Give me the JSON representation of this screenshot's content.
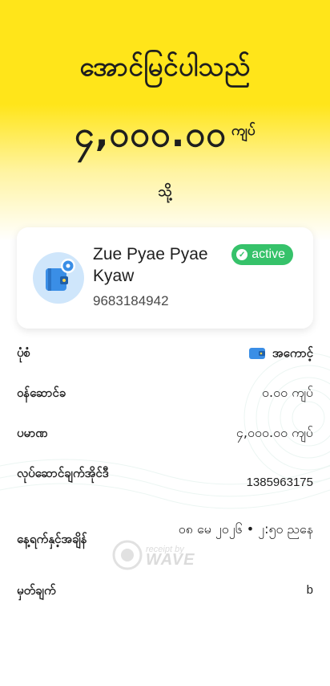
{
  "header": {
    "status_title": "အောင်မြင်ပါသည်",
    "amount": "၄,၀၀၀.၀၀",
    "currency": "ကျပ်",
    "to_label": "သို့"
  },
  "recipient": {
    "name": "Zue Pyae Pyae Kyaw",
    "phone": "9683184942",
    "status": "active",
    "avatar_icon": "wallet-icon"
  },
  "details": [
    {
      "label": "ပုံစံ",
      "value": "အကောင့်"
    },
    {
      "label": "ဝန်ဆောင်ခ",
      "value": "၀.၀၀ ကျပ်"
    },
    {
      "label": "ပမာဏ",
      "value": "၄,၀၀၀.၀၀ ကျပ်"
    },
    {
      "label": "လုပ်ဆောင်ချက်အိုင်ဒီ",
      "value": "1385963175"
    },
    {
      "label": "နေ့ရက်နှင့်အချိန်",
      "value": "၀၈ မေ ၂၀၂၆ • ၂:၅၀ ညနေ"
    },
    {
      "label": "မှတ်ချက်",
      "value": "b"
    }
  ],
  "watermark": {
    "caption": "receipt by",
    "brand": "WAVE"
  },
  "colors": {
    "brand_yellow": "#ffe51a",
    "active_green": "#36c26a",
    "wallet_blue": "#3a8ee6"
  }
}
